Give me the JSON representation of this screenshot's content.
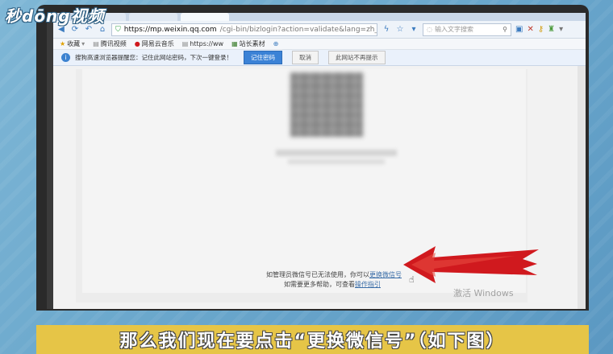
{
  "watermark": {
    "logo_text": "秒dōng视频"
  },
  "browser": {
    "url_host": "https://mp.weixin.qq.com",
    "url_path": "/cgi-bin/bizlogin?action=validate&lang=zh_CN&accour",
    "search_placeholder": "输入文字搜索",
    "bookmarks": [
      {
        "label": "收藏",
        "icon": "star-icon"
      },
      {
        "label": "腾讯视频",
        "icon": "page-icon"
      },
      {
        "label": "网易云音乐",
        "icon": "music-icon"
      },
      {
        "label": "https://ww",
        "icon": "page-icon"
      },
      {
        "label": "站长素材",
        "icon": "site-icon"
      }
    ],
    "notification": {
      "message": "搜狗高速浏览器提醒您：记住此网站密码，下次一键登录！",
      "primary_button": "记住密码",
      "secondary_button": "取消",
      "never_button": "此网站不再提示"
    }
  },
  "page": {
    "help_line1_prefix": "如管理员微信号已无法使用，你可以",
    "help_line1_link": "更换微信号",
    "help_line2_prefix": "如需要更多帮助，可查看",
    "help_line2_link": "操作指引"
  },
  "os": {
    "activate_text": "激活 Windows"
  },
  "subtitle": {
    "text": "那么我们现在要点击“更换微信号”（如下图）"
  },
  "colors": {
    "accent_blue": "#3b82d6",
    "arrow_red": "#d0191e",
    "caption_yellow": "#e6c547"
  }
}
